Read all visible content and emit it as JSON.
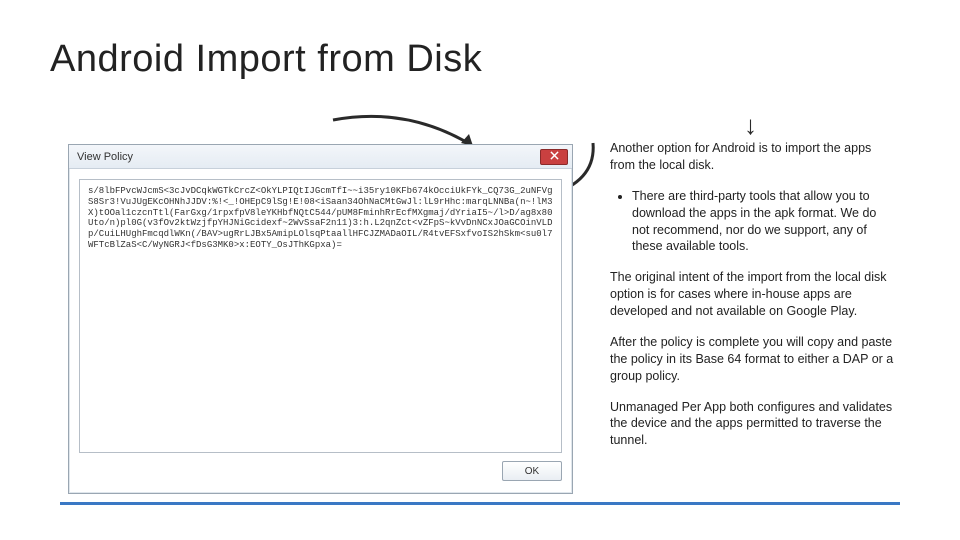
{
  "title": "Android Import from Disk",
  "arrow_glyph": "↓",
  "dialog": {
    "title": "View Policy",
    "policy_text": "s/8lbFPvcWJcmS<3cJvDCqkWGTkCrcZ<OkYLPIQtIJGcmTfI~~i35ry10KFb674kOcciUkFYk_CQ73G_2uNFVgS8Sr3!VuJUgEKcOHNhJJDV:%!<_!OHEpC9lSg!E!08<iSaan34OhNaCMtGwJl:lL9rHhc:marqLNNBa(n~!lM3X)tOOal1czcnTtl(FarGxg/1rpxfpV8leYKHbfNQtC544/pUM8FminhRrEcfMXgmaj/dYriaI5~/l>D/ag8x80Uto/n)pl0G(v3fOv2ktWzjfpYHJNiGcidexf~2WvSsaF2n11)3:h.L2qnZct<vZFpS~kVvDnNCxJOaGCOinVLDp/CuiLHUghFmcqdlWKn(/BAV>ugRrLJBx5AmipLOlsqPtaallHFCJZMADaOIL/R4tvEFSxfvoIS2hSkm<su0l7WFTcBlZaS<C/WyNGRJ<fDsG3MK0>x:EOTY_OsJThKGpxa)=",
    "ok_label": "OK"
  },
  "right": {
    "p1": "Another option for Android is to import the apps from the local disk.",
    "bullet1": "There are third-party tools that allow you to download the apps in the apk format. We do not recommend, nor do we support, any of these available tools.",
    "p2": "The original intent of the import from the local disk option is for cases where in-house apps are developed and not available on Google Play.",
    "p3": "After the policy is complete you will copy and paste the policy in its Base 64 format to either a DAP or a group policy.",
    "p4": "Unmanaged Per App both configures and validates the device and the apps permitted to traverse the tunnel."
  }
}
